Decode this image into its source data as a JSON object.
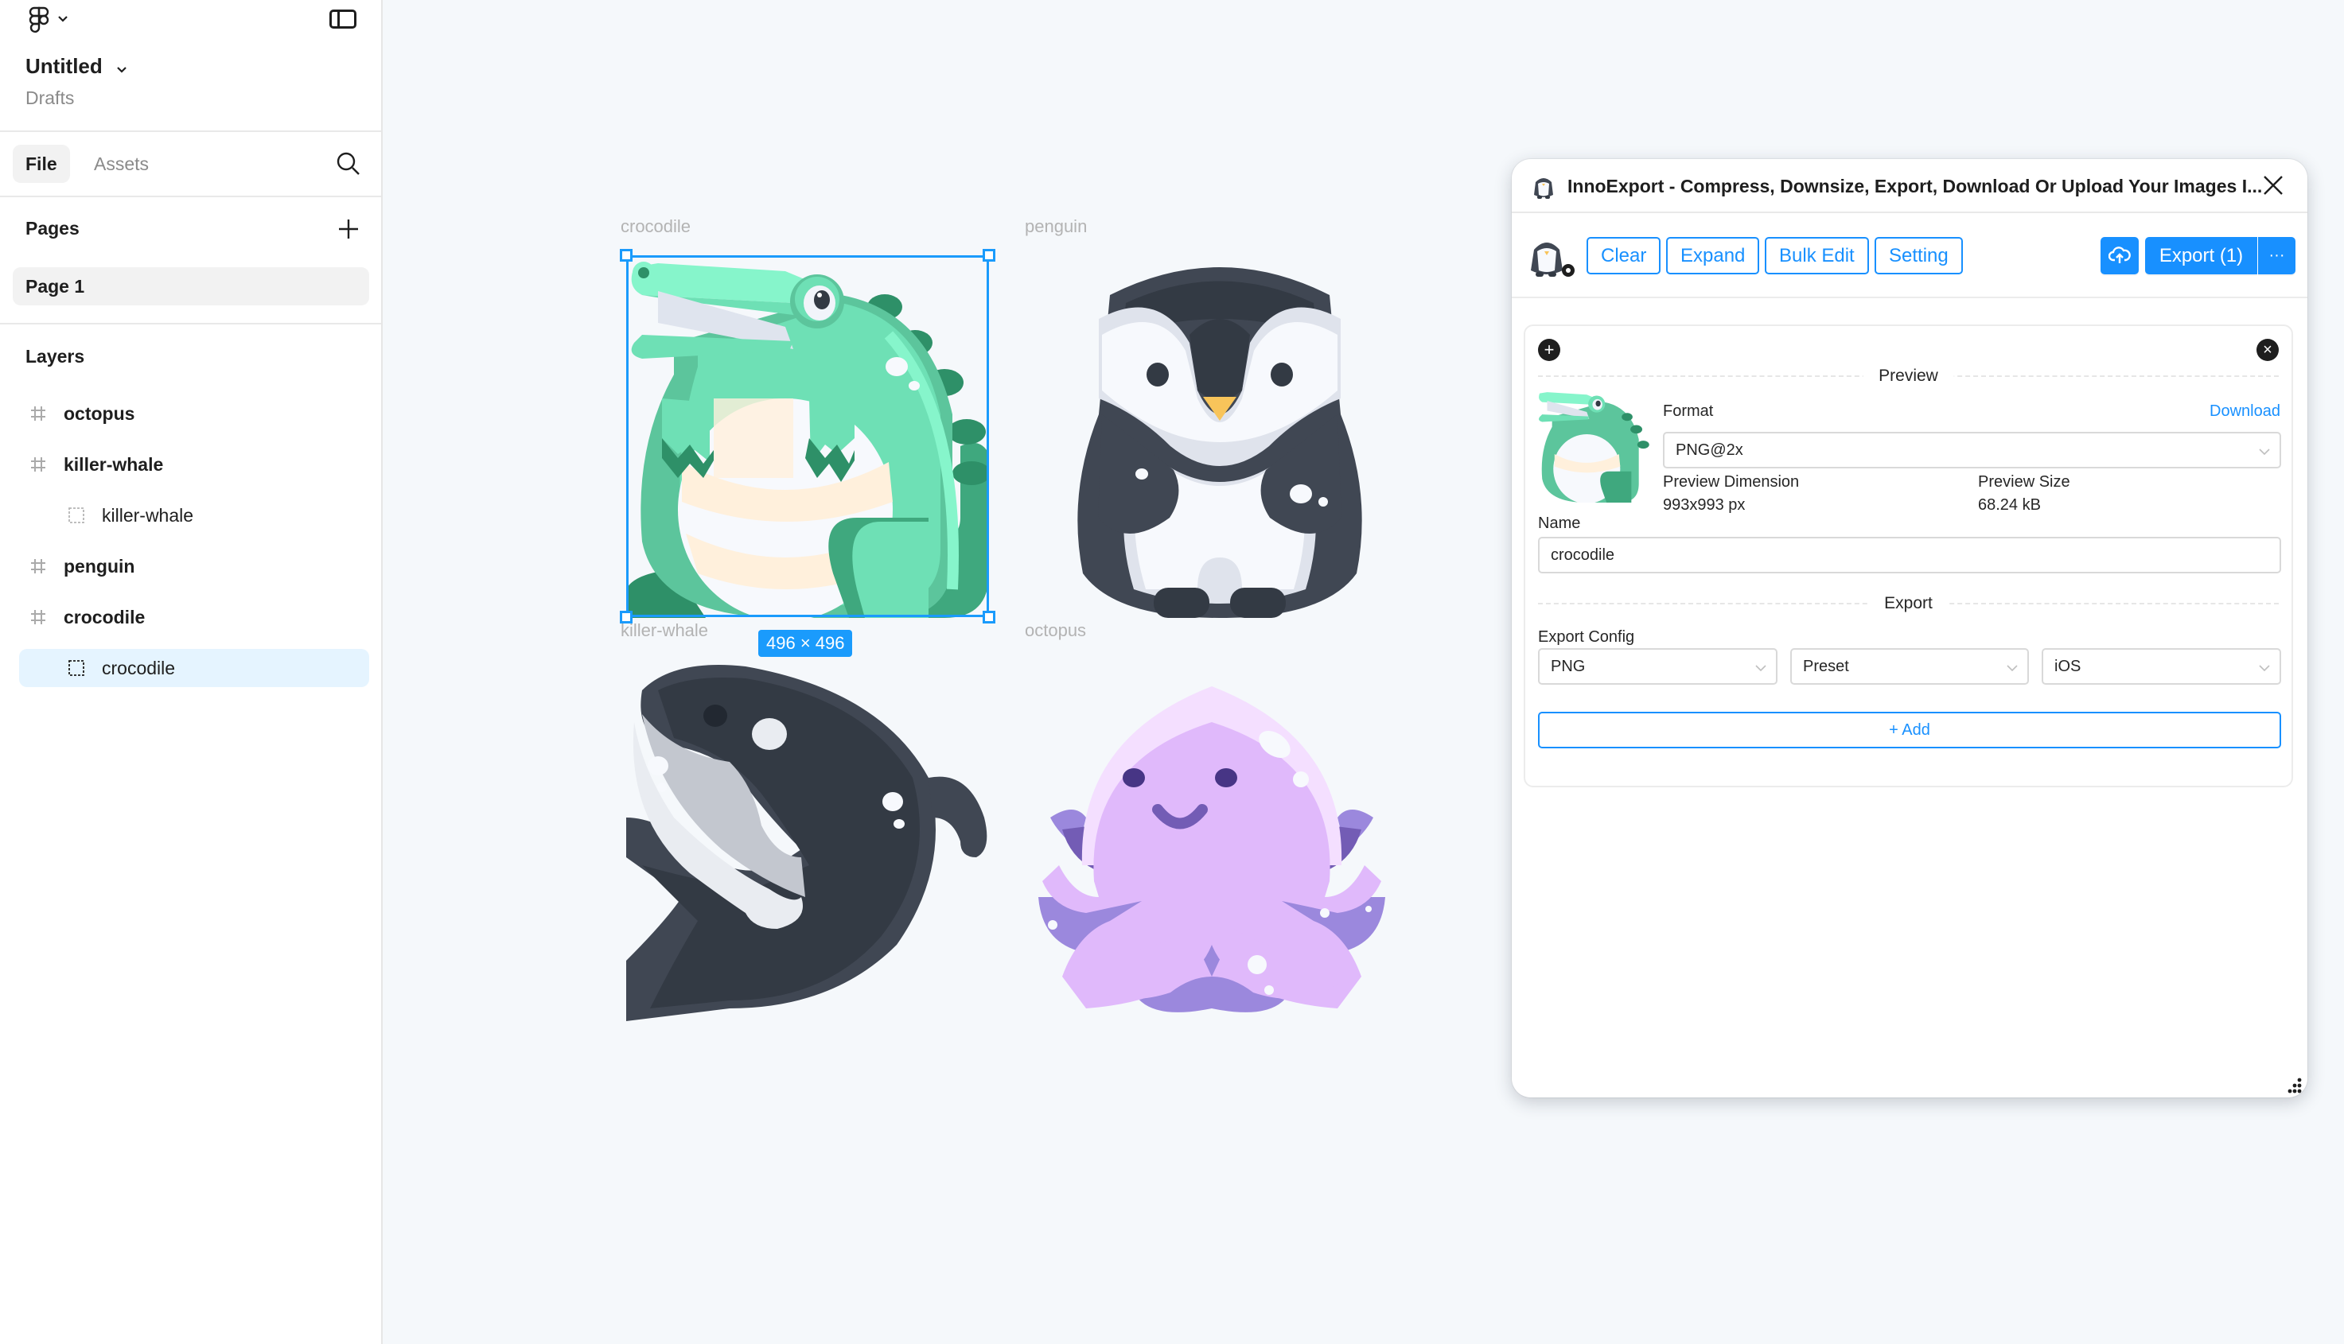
{
  "sidebar": {
    "file_title": "Untitled",
    "file_location": "Drafts",
    "tabs": [
      {
        "label": "File",
        "active": true
      },
      {
        "label": "Assets",
        "active": false
      }
    ],
    "pages_title": "Pages",
    "pages": [
      {
        "label": "Page 1",
        "active": true
      }
    ],
    "layers_title": "Layers",
    "layers": [
      {
        "label": "octopus",
        "type": "frame",
        "selected": false
      },
      {
        "label": "killer-whale",
        "type": "frame",
        "selected": false
      },
      {
        "label": "killer-whale",
        "type": "image",
        "selected": false
      },
      {
        "label": "penguin",
        "type": "frame",
        "selected": false
      },
      {
        "label": "crocodile",
        "type": "frame",
        "selected": false
      },
      {
        "label": "crocodile",
        "type": "image",
        "selected": true
      }
    ],
    "icons": {
      "logo": "figma-logo-icon",
      "panel_toggle": "sidebar-toggle-icon",
      "search": "search-icon",
      "add_page": "plus-icon",
      "frame": "hash-frame-icon",
      "image": "dashed-square-icon"
    }
  },
  "canvas": {
    "frames": [
      {
        "label": "crocodile",
        "selected": true
      },
      {
        "label": "penguin",
        "selected": false
      },
      {
        "label": "killer-whale",
        "selected": false
      },
      {
        "label": "octopus",
        "selected": false
      }
    ],
    "selection_size": "496 × 496",
    "selection_color": "#1a9bfc"
  },
  "plugin": {
    "title": "InnoExport - Compress, Downsize, Export, Download Or Upload Your Images I...",
    "toolbar": {
      "clear": "Clear",
      "expand": "Expand",
      "bulk_edit": "Bulk Edit",
      "setting": "Setting",
      "export": "Export (1)",
      "more": "···"
    },
    "accent_color": "#1890ff",
    "item": {
      "add_symbol": "+",
      "remove_symbol": "×",
      "preview_heading": "Preview",
      "format_label": "Format",
      "download_link": "Download",
      "format_value": "PNG@2x",
      "preview_dimension_label": "Preview Dimension",
      "preview_dimension_value": "993x993 px",
      "preview_size_label": "Preview Size",
      "preview_size_value": "68.24 kB",
      "name_label": "Name",
      "name_value": "crocodile",
      "export_heading": "Export",
      "export_config_label": "Export Config",
      "export_config": {
        "format": "PNG",
        "mode": "Preset",
        "platform": "iOS"
      },
      "add_button": "+ Add"
    }
  }
}
